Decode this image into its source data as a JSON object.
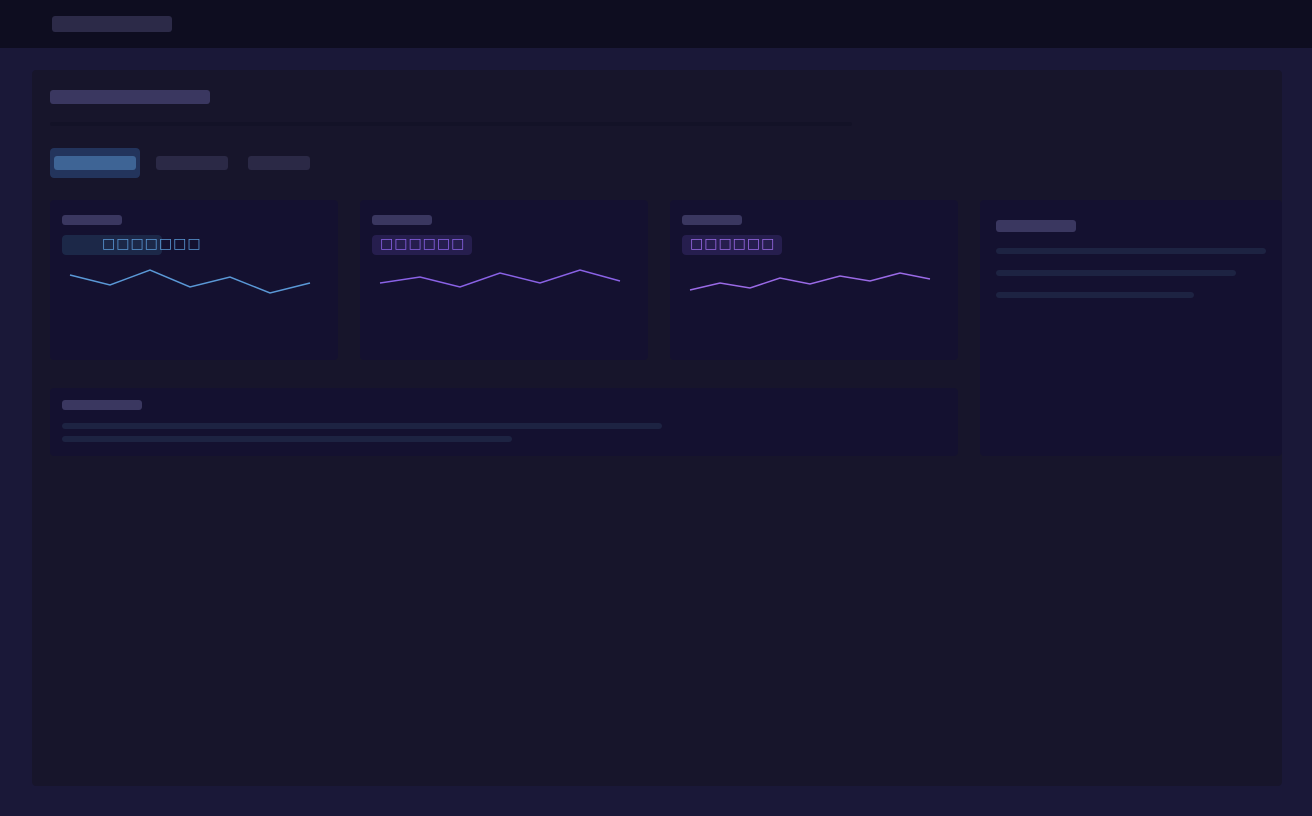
{
  "metrics": [
    {
      "badge_text": "□□□□□□□",
      "accent": "#5a98d6",
      "sparkline": [
        30,
        20,
        35,
        18,
        28,
        12,
        22
      ]
    },
    {
      "badge_text": "□□□□□□",
      "accent": "#8a62e6",
      "sparkline": [
        22,
        28,
        18,
        32,
        22,
        35,
        24
      ]
    },
    {
      "badge_text": "□□□□□□",
      "accent": "#9a6ae6",
      "sparkline": [
        15,
        22,
        17,
        27,
        21,
        29,
        24,
        32,
        26
      ]
    }
  ],
  "tabs": [
    {
      "state": "active",
      "accent": "#3e6495"
    },
    {
      "state": "inactive"
    },
    {
      "state": "inactive"
    }
  ],
  "colors": {
    "background": "#1a1838",
    "topbar": "#0e0d20",
    "panel": "#17152b",
    "card": "#141130",
    "placeholder_text": "#3a3760"
  }
}
